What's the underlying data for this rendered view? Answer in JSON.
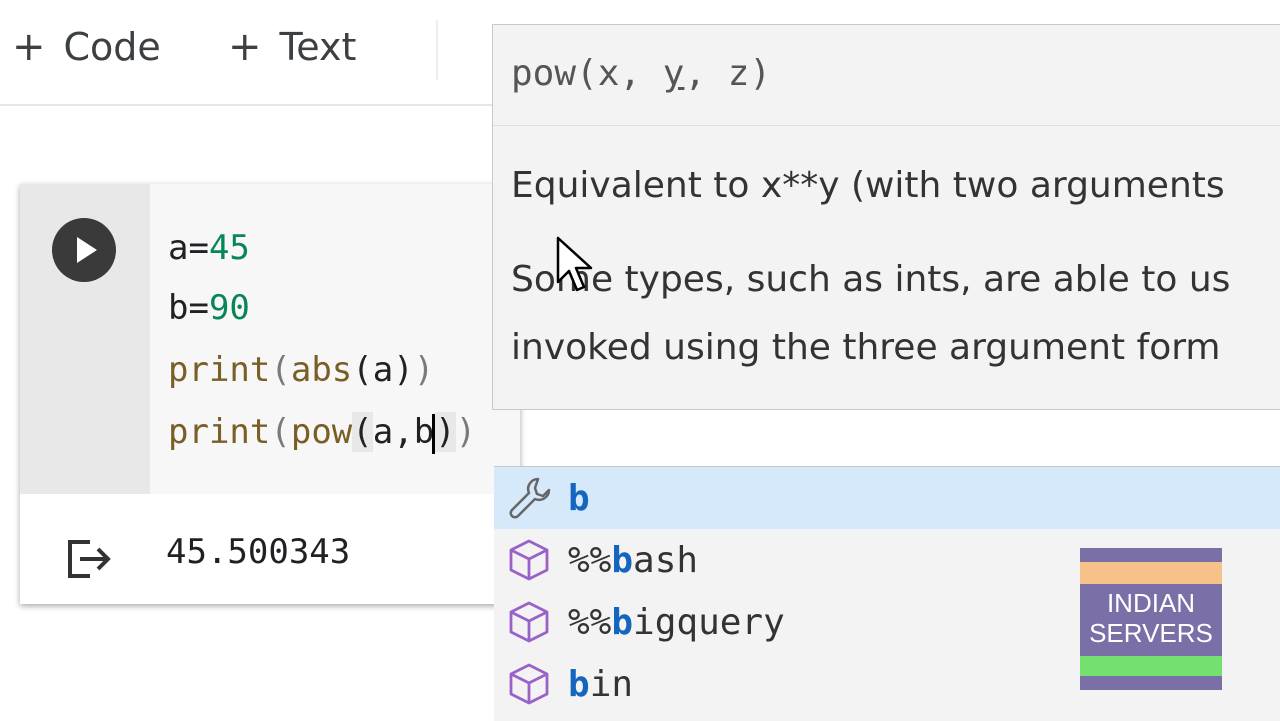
{
  "toolbar": {
    "add_code_label": "Code",
    "add_text_label": "Text",
    "plus": "+"
  },
  "cell": {
    "code_lines": {
      "l1_var": "a=",
      "l1_num": "45",
      "l2_var": "b=",
      "l2_num": "90",
      "l3_print": "print",
      "l3_open": "(",
      "l3_abs": "abs",
      "l3_inner": "(a)",
      "l3_close": ")",
      "l4_print": "print",
      "l4_open": "(",
      "l4_pow": "pow",
      "l4_inner_open": "(",
      "l4_args": "a,b",
      "l4_inner_close": ")",
      "l4_close": ")"
    },
    "output": "45.500343"
  },
  "signature_help": {
    "signature_prefix": "pow(x, ",
    "signature_active": "y",
    "signature_suffix": ", z)",
    "doc_line_1": "Equivalent to x**y (with two arguments",
    "doc_line_2": "Some types, such as ints, are able to us",
    "doc_line_3": "invoked using the three argument form"
  },
  "completions": {
    "items": [
      {
        "match": "b",
        "rest": "",
        "prefix": "",
        "icon": "wrench-icon",
        "selected": true
      },
      {
        "prefix": "%%",
        "match": "b",
        "rest": "ash",
        "icon": "cube-icon"
      },
      {
        "prefix": "%%",
        "match": "b",
        "rest": "igquery",
        "icon": "cube-icon"
      },
      {
        "prefix": "",
        "match": "b",
        "rest": "in",
        "icon": "cube-icon"
      }
    ]
  },
  "watermark": {
    "line1": "INDIAN",
    "line2": "SERVERS",
    "colors": {
      "top": "#f6c289",
      "middle": "#7b6fa8",
      "bottom": "#74e06f"
    }
  },
  "colors": {
    "number": "#098658",
    "function": "#795e26",
    "completion_match": "#1565c0",
    "selected_row": "#d6e9fb"
  }
}
